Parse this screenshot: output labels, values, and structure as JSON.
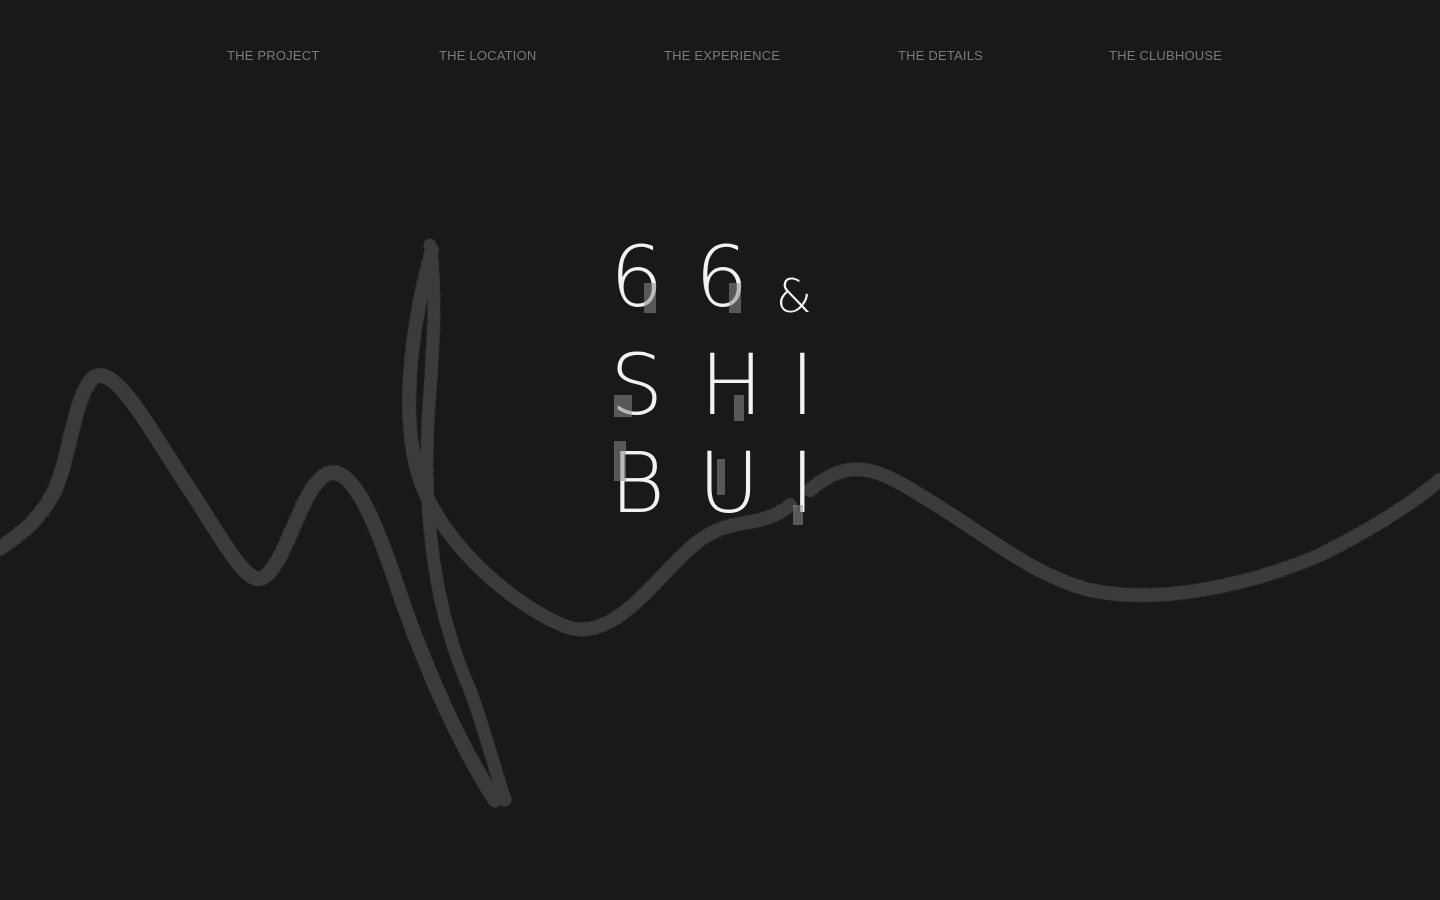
{
  "nav": {
    "items": [
      {
        "label": "THE PROJECT"
      },
      {
        "label": "THE LOCATION"
      },
      {
        "label": "THE EXPERIENCE"
      },
      {
        "label": "THE DETAILS"
      },
      {
        "label": "THE CLUBHOUSE"
      }
    ]
  },
  "logo": {
    "row1": [
      "6",
      "6",
      "&"
    ],
    "row2": [
      "S",
      "H",
      "I"
    ],
    "row3": [
      "B",
      "U",
      "I"
    ]
  },
  "colors": {
    "background": "#191919",
    "nav_text": "#7a7a7a",
    "logo_text": "#f2f2f2",
    "scribble": "#3a3a3a"
  }
}
